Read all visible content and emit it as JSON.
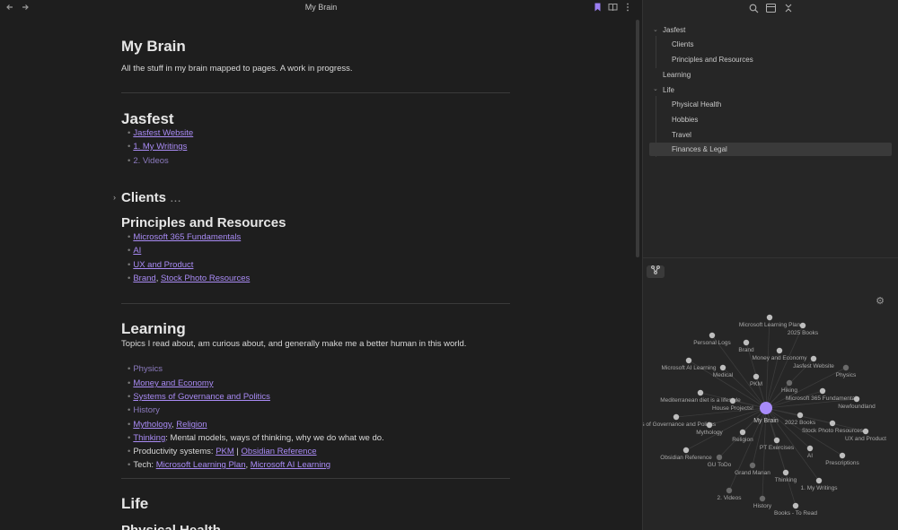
{
  "window": {
    "title": "My Brain"
  },
  "note": {
    "title": "My Brain",
    "intro": "All the stuff in my brain mapped to pages. A work in progress.",
    "jasfest": {
      "heading": "Jasfest",
      "links": [
        "Jasfest Website",
        "1. My Writings",
        "2. Videos"
      ]
    },
    "clients": {
      "heading": "Clients",
      "collapsed_marker": "..."
    },
    "principles": {
      "heading": "Principles and Resources",
      "links": [
        "Microsoft 365 Fundamentals",
        "AI",
        "UX and Product",
        "Brand",
        "Stock Photo Resources"
      ]
    },
    "learning": {
      "heading": "Learning",
      "desc": "Topics I read about, am curious about, and generally make me a better human in this world.",
      "physics": "Physics",
      "money": "Money and Economy",
      "systems": "Systems of Governance and Politics",
      "history": "History",
      "mythology": "Mythology",
      "religion": "Religion",
      "thinking": "Thinking",
      "thinking_desc": ": Mental models, ways of thinking, why we do what we do.",
      "productivity_prefix": "Productivity systems: ",
      "pkm": "PKM",
      "separator": " | ",
      "obsidian": "Obsidian Reference",
      "tech_prefix": "Tech: ",
      "tech_sep": ", ",
      "ms_learning": "Microsoft Learning Plan",
      "ms_ai": "Microsoft AI Learning"
    },
    "life": {
      "heading": "Life",
      "partial_heading": "Physical Health"
    },
    "comma": ", "
  },
  "outline": {
    "items": [
      {
        "label": "Jasfest"
      },
      {
        "label": "Clients"
      },
      {
        "label": "Principles and Resources"
      },
      {
        "label": "Learning"
      },
      {
        "label": "Life"
      },
      {
        "label": "Physical Health"
      },
      {
        "label": "Hobbies"
      },
      {
        "label": "Travel"
      },
      {
        "label": "Finances & Legal"
      }
    ]
  },
  "graph": {
    "center_label": "My Brain",
    "nodes": [
      "Microsoft Learning Plan",
      "2025 Books",
      "Personal Logs",
      "Brand",
      "Money and Economy",
      "Jasfest Website",
      "Microsoft AI Learning",
      "Medical",
      "Physics",
      "PKM",
      "Hiking",
      "Microsoft 365 Fundamentals",
      "Mediterranean diet is a lifestyle",
      "House Projects!",
      "Newfoundland",
      "2022 Books",
      "Stock Photo Resources",
      "UX and Product",
      "ms of Governance and Politics",
      "Mythology",
      "Religion",
      "PT Exercises",
      "AI",
      "Obsidian Reference",
      "GU ToDo",
      "Grand Manan",
      "Prescriptions",
      "Thinking",
      "1. My Writings",
      "2. Videos",
      "History",
      "Books - To Read"
    ],
    "accent": "#a88bfa"
  },
  "icons": [
    "back-arrow-icon",
    "forward-arrow-icon",
    "bookmark-icon",
    "reading-mode-icon",
    "more-options-icon",
    "search-icon",
    "layout-icon",
    "collapse-icon",
    "graph-icon",
    "settings-icon"
  ]
}
